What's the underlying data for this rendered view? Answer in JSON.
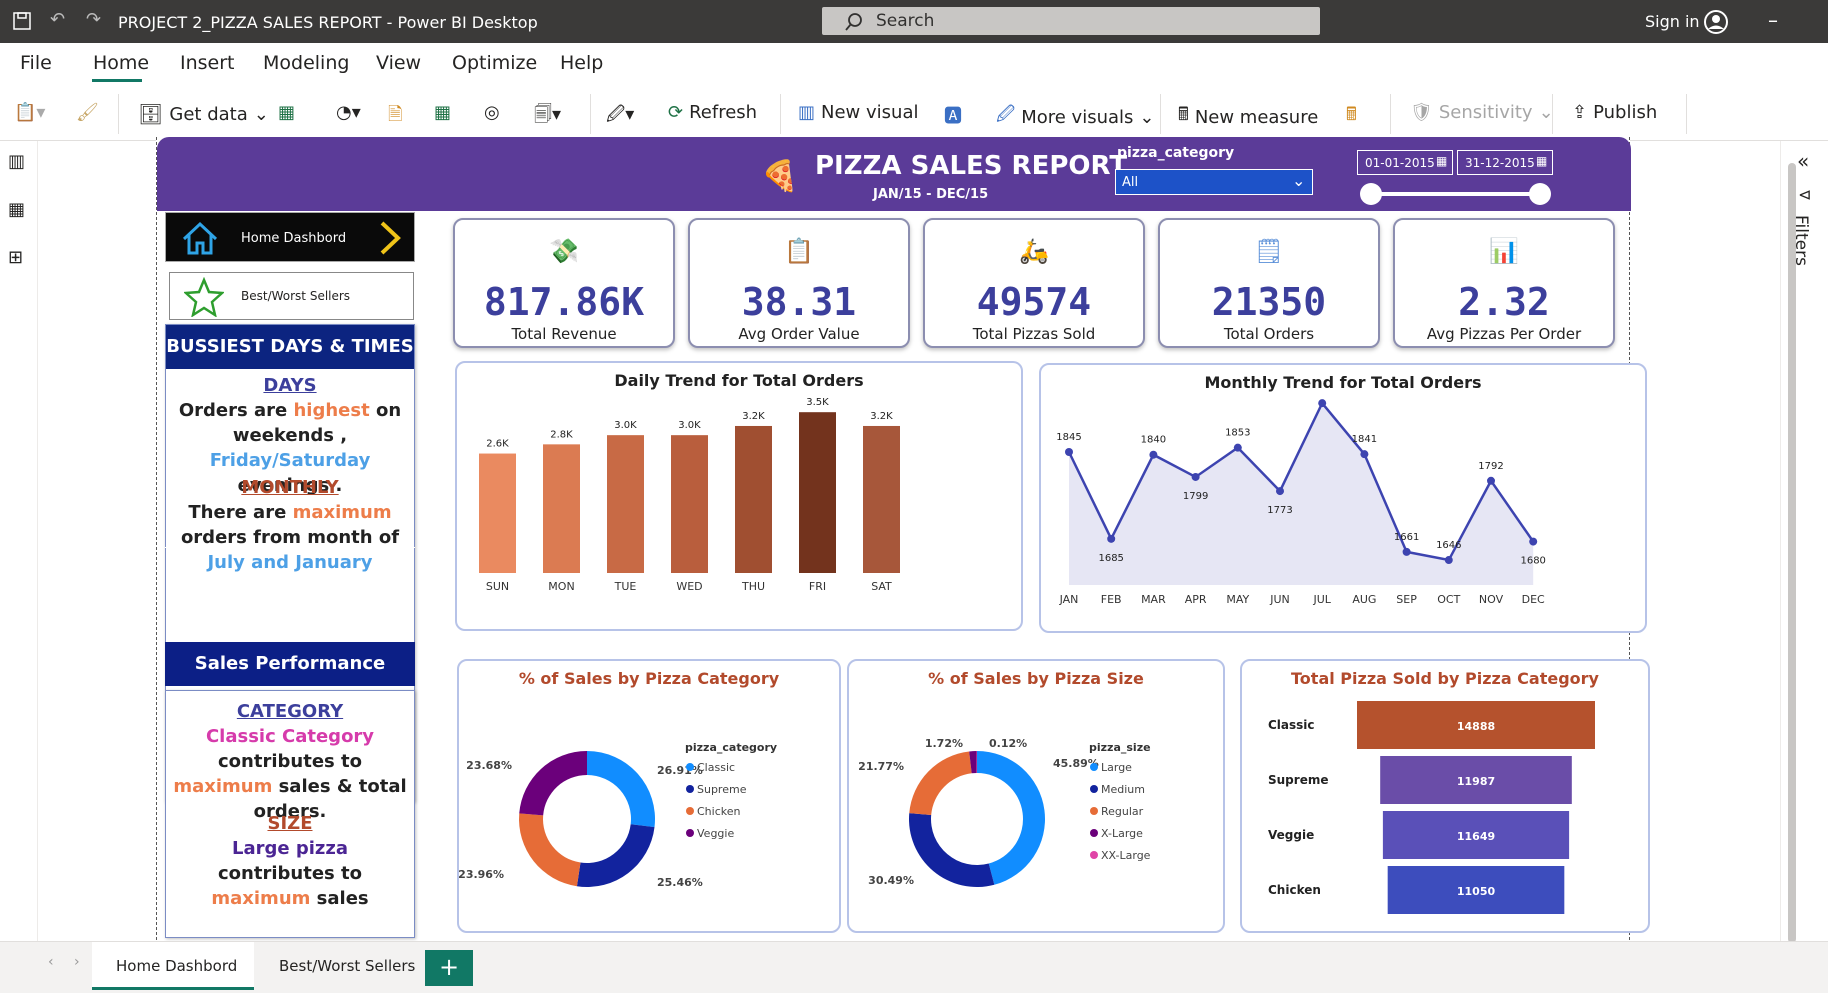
{
  "window": {
    "title": "PROJECT 2_PIZZA SALES REPORT - Power BI Desktop",
    "search_placeholder": "Search",
    "sign_in": "Sign in"
  },
  "menu": [
    "File",
    "Home",
    "Insert",
    "Modeling",
    "View",
    "Optimize",
    "Help"
  ],
  "ribbon": {
    "get_data": "Get data",
    "refresh": "Refresh",
    "new_visual": "New visual",
    "more_visuals": "More visuals",
    "new_measure": "New measure",
    "sensitivity": "Sensitivity",
    "publish": "Publish"
  },
  "filters_label": "Filters",
  "header": {
    "title": "PIZZA SALES REPORT",
    "subtitle": "JAN/15 - DEC/15",
    "slicer_label": "pizza_category",
    "slicer_value": "All",
    "date_from": "01-01-2015",
    "date_to": "31-12-2015"
  },
  "nav": {
    "home": "Home Dashbord",
    "best_worst": "Best/Worst Sellers"
  },
  "busiest": {
    "heading": "BUSSIEST DAYS & TIMES",
    "days_title": "DAYS",
    "days_text": [
      "Orders are ",
      "highest",
      " on weekends , ",
      "Friday/Saturday",
      " evenings ."
    ],
    "monthly_title": "MONTHLY",
    "monthly_text": [
      "There are ",
      "maximum",
      " orders from month of ",
      "July and January"
    ]
  },
  "performance": {
    "heading": "Sales Performance",
    "category_title": "CATEGORY",
    "category_text": [
      "Classic Category",
      " contributes to ",
      "maximum",
      " sales & total orders."
    ],
    "size_title": "SIZE",
    "size_text": [
      "Large pizza",
      " contributes to ",
      "maximum",
      " sales"
    ]
  },
  "kpis": [
    {
      "value": "817.86K",
      "label": "Total Revenue"
    },
    {
      "value": "38.31",
      "label": "Avg Order Value"
    },
    {
      "value": "49574",
      "label": "Total Pizzas Sold"
    },
    {
      "value": "21350",
      "label": "Total Orders"
    },
    {
      "value": "2.32",
      "label": "Avg Pizzas Per Order"
    }
  ],
  "colors": {
    "accent": "#5b3b98",
    "kpi": "#3c3f9c",
    "navy": "#0c2480"
  },
  "chart_data": [
    {
      "type": "bar",
      "title": "Daily Trend for Total Orders",
      "categories": [
        "SUN",
        "MON",
        "TUE",
        "WED",
        "THU",
        "FRI",
        "SAT"
      ],
      "values": [
        2.6,
        2.8,
        3.0,
        3.0,
        3.2,
        3.5,
        3.2
      ],
      "labels": [
        "2.6K",
        "2.8K",
        "3.0K",
        "3.0K",
        "3.2K",
        "3.5K",
        "3.2K"
      ],
      "colors": [
        "#ea8a60",
        "#db7b52",
        "#c86a45",
        "#b95e3d",
        "#a04f31",
        "#73331d",
        "#a7573a"
      ]
    },
    {
      "type": "area",
      "title": "Monthly Trend for Total Orders",
      "categories": [
        "JAN",
        "FEB",
        "MAR",
        "APR",
        "MAY",
        "JUN",
        "JUL",
        "AUG",
        "SEP",
        "OCT",
        "NOV",
        "DEC"
      ],
      "values": [
        1845,
        1685,
        1840,
        1799,
        1853,
        1773,
        1935,
        1841,
        1661,
        1646,
        1792,
        1680
      ]
    },
    {
      "type": "pie",
      "title": "% of Sales by Pizza Category",
      "legend_title": "pizza_category",
      "series": [
        {
          "name": "Classic",
          "value": 26.91,
          "label": "26.91%",
          "color": "#118dff"
        },
        {
          "name": "Supreme",
          "value": 25.46,
          "label": "25.46%",
          "color": "#12239e"
        },
        {
          "name": "Chicken",
          "value": 23.96,
          "label": "23.96%",
          "color": "#e66c37"
        },
        {
          "name": "Veggie",
          "value": 23.68,
          "label": "23.68%",
          "color": "#6b007b"
        }
      ]
    },
    {
      "type": "pie",
      "title": "% of Sales by Pizza Size",
      "legend_title": "pizza_size",
      "series": [
        {
          "name": "Large",
          "value": 45.89,
          "label": "45.89%",
          "color": "#118dff"
        },
        {
          "name": "Medium",
          "value": 30.49,
          "label": "30.49%",
          "color": "#12239e"
        },
        {
          "name": "Regular",
          "value": 21.77,
          "label": "21.77%",
          "color": "#e66c37"
        },
        {
          "name": "X-Large",
          "value": 1.72,
          "label": "1.72%",
          "color": "#6b007b"
        },
        {
          "name": "XX-Large",
          "value": 0.12,
          "label": "0.12%",
          "color": "#e044a7"
        }
      ]
    },
    {
      "type": "bar",
      "title": "Total Pizza Sold by Pizza Category",
      "categories": [
        "Classic",
        "Supreme",
        "Veggie",
        "Chicken"
      ],
      "values": [
        14888,
        11987,
        11649,
        11050
      ],
      "colors": [
        "#b5522d",
        "#6a4da8",
        "#5a50b8",
        "#3d4dbd"
      ]
    }
  ],
  "tabs": {
    "home": "Home Dashbord",
    "best_worst": "Best/Worst Sellers",
    "add": "+"
  }
}
